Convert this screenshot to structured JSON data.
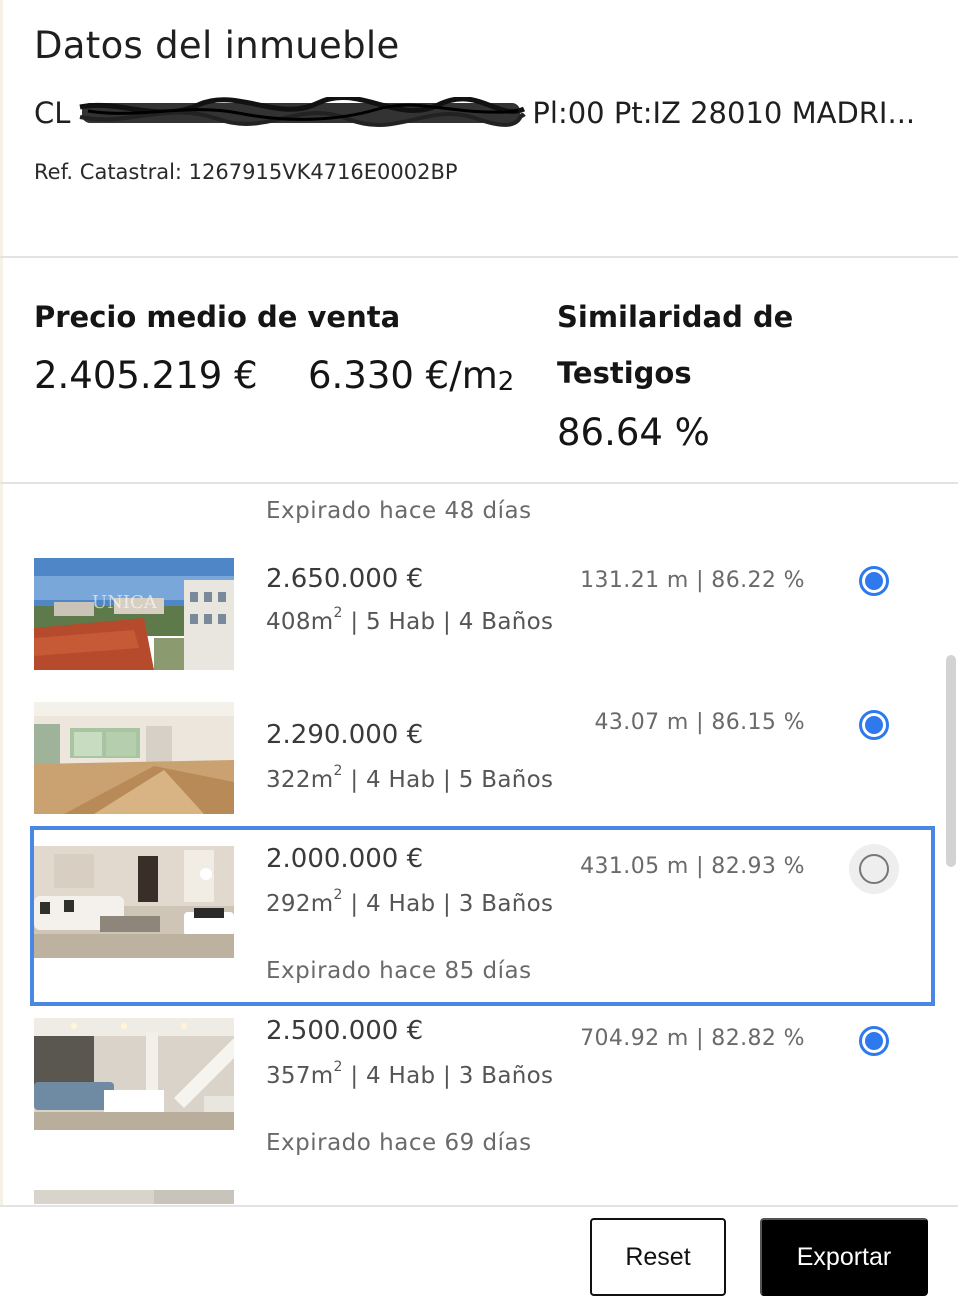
{
  "header": {
    "title": "Datos del inmueble",
    "address_prefix": "CL",
    "address_suffix": "Pl:00 Pt:IZ 28010 MADRI...",
    "ref": "Ref. Catastral: 1267915VK4716E0002BP"
  },
  "stats": {
    "avg_price_label": "Precio medio de venta",
    "avg_price_value": "2.405.219 €",
    "price_per_m2_value": "6.330 €/m",
    "price_per_m2_unit": "2",
    "similarity_label_line1": "Similaridad de",
    "similarity_label_line2": "Testigos",
    "similarity_value": "86.64 %"
  },
  "listings": {
    "top_partial_expired": "Expirado hace 48 días",
    "items": [
      {
        "price": "2.650.000 €",
        "area": "408m",
        "area_sup": "2",
        "rest": " | 5 Hab | 4 Baños",
        "metric": "131.21 m | 86.22 %",
        "expired": "",
        "selected": true,
        "thumb_watermark": "UNICA"
      },
      {
        "price": "2.290.000 €",
        "area": "322m",
        "area_sup": "2",
        "rest": " | 4 Hab | 5 Baños",
        "metric": "43.07 m | 86.15 %",
        "expired": "",
        "selected": true
      },
      {
        "price": "2.000.000 €",
        "area": "292m",
        "area_sup": "2",
        "rest": " | 4 Hab | 3 Baños",
        "metric": "431.05 m | 82.93 %",
        "expired": "Expirado hace 85 días",
        "selected": false
      },
      {
        "price": "2.500.000 €",
        "area": "357m",
        "area_sup": "2",
        "rest": " | 4 Hab | 3 Baños",
        "metric": "704.92 m | 82.82 %",
        "expired": "Expirado hace 69 días",
        "selected": true
      }
    ]
  },
  "footer": {
    "reset_label": "Reset",
    "export_label": "Exportar"
  },
  "colors": {
    "accent": "#2f79ee",
    "focus_border": "#4a86e3",
    "button_dark": "#000000"
  }
}
